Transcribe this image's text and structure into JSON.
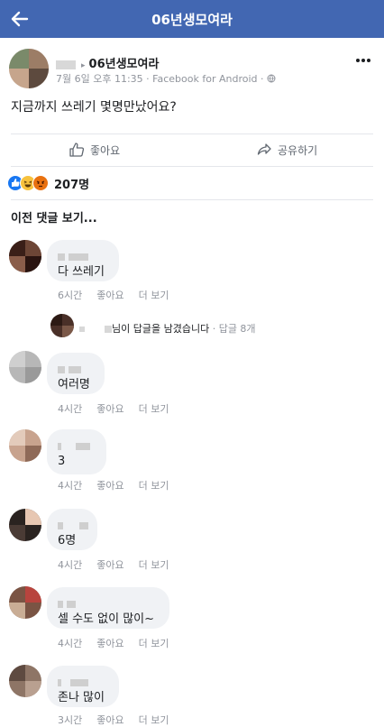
{
  "appbar": {
    "title": "06년생모여라",
    "back_icon": "arrow-left-icon"
  },
  "post": {
    "group_name": "06년생모여라",
    "date": "7월 6일 오후 11:35",
    "via": "Facebook for Android",
    "text": "지금까지 쓰레기 몇명만났어요?",
    "like_label": "좋아요",
    "share_label": "공유하기",
    "reaction_count": "207명",
    "prev_comments_label": "이전 댓글 보기..."
  },
  "comments": [
    {
      "text": "다 쓰레기",
      "time": "6시간",
      "like": "좋아요",
      "more": "더 보기"
    },
    {
      "text": "여러명",
      "time": "4시간",
      "like": "좋아요",
      "more": "더 보기"
    },
    {
      "text": "3",
      "time": "4시간",
      "like": "좋아요",
      "more": "더 보기"
    },
    {
      "text": "6명",
      "time": "4시간",
      "like": "좋아요",
      "more": "더 보기"
    },
    {
      "text": "셀 수도 없이 많이~",
      "time": "4시간",
      "like": "좋아요",
      "more": "더 보기"
    },
    {
      "text": "존나 많이",
      "time": "3시간",
      "like": "좋아요",
      "more": "더 보기"
    }
  ],
  "reply_summary": {
    "text": "님이 답글을 남겼습니다",
    "count": "· 답글 8개"
  },
  "colors": {
    "brand": "#4267b2",
    "bubble": "#f0f2f5",
    "meta": "#90949c"
  }
}
